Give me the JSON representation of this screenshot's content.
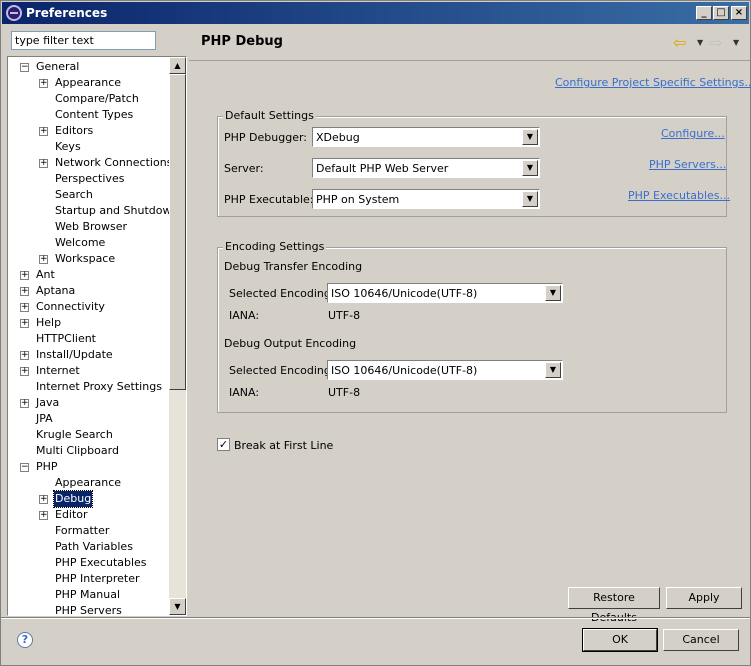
{
  "window": {
    "title": "Preferences",
    "min_glyph": "_",
    "max_glyph": "□",
    "close_glyph": "×"
  },
  "filter": {
    "placeholder": "type filter text",
    "value": "type filter text"
  },
  "tree": {
    "items": [
      {
        "label": "General",
        "level": 0,
        "expander": "−"
      },
      {
        "label": "Appearance",
        "level": 1,
        "expander": "+"
      },
      {
        "label": "Compare/Patch",
        "level": 1,
        "expander": ""
      },
      {
        "label": "Content Types",
        "level": 1,
        "expander": ""
      },
      {
        "label": "Editors",
        "level": 1,
        "expander": "+"
      },
      {
        "label": "Keys",
        "level": 1,
        "expander": ""
      },
      {
        "label": "Network Connections",
        "level": 1,
        "expander": "+"
      },
      {
        "label": "Perspectives",
        "level": 1,
        "expander": ""
      },
      {
        "label": "Search",
        "level": 1,
        "expander": ""
      },
      {
        "label": "Startup and Shutdown",
        "level": 1,
        "expander": ""
      },
      {
        "label": "Web Browser",
        "level": 1,
        "expander": ""
      },
      {
        "label": "Welcome",
        "level": 1,
        "expander": ""
      },
      {
        "label": "Workspace",
        "level": 1,
        "expander": "+"
      },
      {
        "label": "Ant",
        "level": 0,
        "expander": "+"
      },
      {
        "label": "Aptana",
        "level": 0,
        "expander": "+"
      },
      {
        "label": "Connectivity",
        "level": 0,
        "expander": "+"
      },
      {
        "label": "Help",
        "level": 0,
        "expander": "+"
      },
      {
        "label": "HTTPClient",
        "level": 0,
        "expander": ""
      },
      {
        "label": "Install/Update",
        "level": 0,
        "expander": "+"
      },
      {
        "label": "Internet",
        "level": 0,
        "expander": "+"
      },
      {
        "label": "Internet Proxy Settings",
        "level": 0,
        "expander": ""
      },
      {
        "label": "Java",
        "level": 0,
        "expander": "+"
      },
      {
        "label": "JPA",
        "level": 0,
        "expander": ""
      },
      {
        "label": "Krugle Search",
        "level": 0,
        "expander": ""
      },
      {
        "label": "Multi Clipboard",
        "level": 0,
        "expander": ""
      },
      {
        "label": "PHP",
        "level": 0,
        "expander": "−"
      },
      {
        "label": "Appearance",
        "level": 1,
        "expander": ""
      },
      {
        "label": "Debug",
        "level": 1,
        "expander": "+",
        "selected": true
      },
      {
        "label": "Editor",
        "level": 1,
        "expander": "+"
      },
      {
        "label": "Formatter",
        "level": 1,
        "expander": ""
      },
      {
        "label": "Path Variables",
        "level": 1,
        "expander": ""
      },
      {
        "label": "PHP Executables",
        "level": 1,
        "expander": ""
      },
      {
        "label": "PHP Interpreter",
        "level": 1,
        "expander": ""
      },
      {
        "label": "PHP Manual",
        "level": 1,
        "expander": ""
      },
      {
        "label": "PHP Servers",
        "level": 1,
        "expander": ""
      }
    ]
  },
  "page": {
    "title": "PHP Debug",
    "configure_project_link": "Configure Project Specific Settings...",
    "default_settings": {
      "title": "Default Settings",
      "debugger_label": "PHP Debugger:",
      "debugger_value": "XDebug",
      "configure_link": "Configure...",
      "server_label": "Server:",
      "server_value": "Default PHP Web Server",
      "servers_link": "PHP Servers...",
      "executable_label": "PHP Executable:",
      "executable_value": "PHP on System",
      "executables_link": "PHP Executables..."
    },
    "encoding_settings": {
      "title": "Encoding Settings",
      "transfer_heading": "Debug Transfer Encoding",
      "transfer_label": "Selected Encoding:",
      "transfer_value": "ISO 10646/Unicode(UTF-8)",
      "transfer_iana_label": "IANA:",
      "transfer_iana_value": "UTF-8",
      "output_heading": "Debug Output Encoding",
      "output_label": "Selected Encoding:",
      "output_value": "ISO 10646/Unicode(UTF-8)",
      "output_iana_label": "IANA:",
      "output_iana_value": "UTF-8"
    },
    "break_first_line": {
      "label": "Break at First Line",
      "checked": "✓"
    }
  },
  "buttons": {
    "restore_defaults": "Restore Defaults",
    "apply": "Apply",
    "ok": "OK",
    "cancel": "Cancel"
  },
  "icons": {
    "back_glyph": "⇦",
    "forward_glyph": "⇨",
    "caret_glyph": "▼",
    "combo_arrow": "▼",
    "scroll_up": "▲",
    "scroll_down": "▼",
    "help_glyph": "?"
  },
  "colors": {
    "selection": "#0a246a",
    "link": "#3a6ecc",
    "titlebar": "#0a246a"
  }
}
